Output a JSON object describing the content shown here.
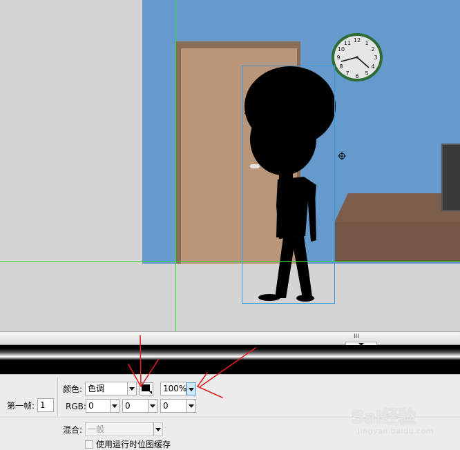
{
  "stage": {
    "wall_color": "#6699cc",
    "guide_color": "#38d838",
    "clock_numbers": [
      "12",
      "1",
      "2",
      "3",
      "4",
      "5",
      "6",
      "7",
      "8",
      "9",
      "10",
      "11"
    ]
  },
  "scrollbar": {
    "grip_glyph": "III"
  },
  "properties": {
    "frame_label": "第一帧:",
    "frame_value": "1",
    "color_label": "颜色:",
    "color_mode_value": "色调",
    "tint_color": "#000000",
    "percent_value": "100%",
    "rgb_label": "RGB:",
    "rgb_values": [
      "0",
      "0",
      "0"
    ],
    "blend_label": "混合:",
    "blend_value": "一般",
    "cache_label": "使用运行时位图缓存",
    "cache_checked": false
  },
  "annotations": {
    "color": "#e02020"
  },
  "watermark": {
    "logo": "Bai经验",
    "url": "jingyan.baidu.com"
  }
}
